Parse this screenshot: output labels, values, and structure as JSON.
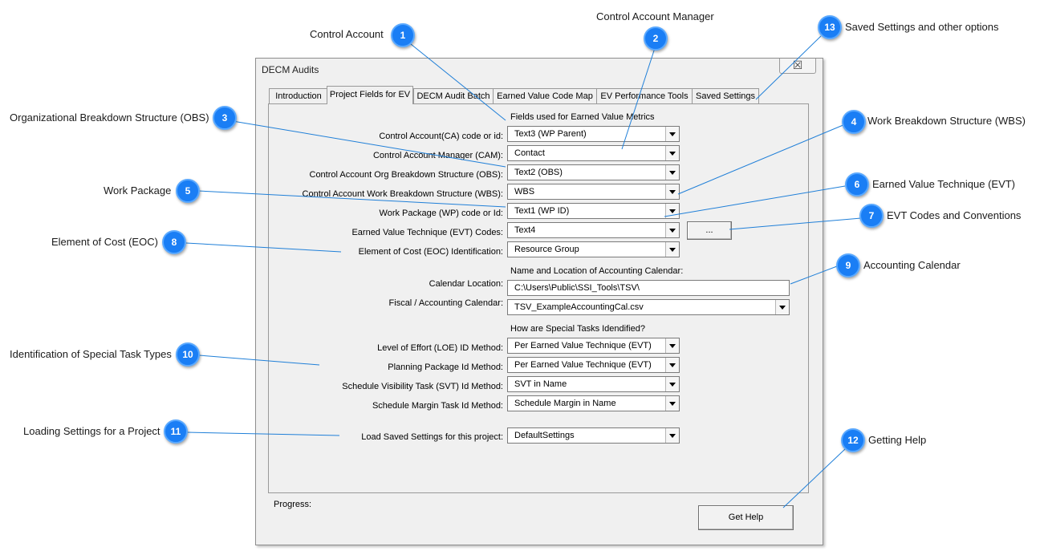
{
  "dialog": {
    "title": "DECM Audits",
    "close_glyph": "☒",
    "tabs": [
      "Introduction",
      "Project Fields for EV",
      "DECM Audit Batch",
      "Earned Value Code Map",
      "EV Performance Tools",
      "Saved Settings"
    ],
    "active_tab": "Project Fields for EV",
    "section_headers": {
      "ev_metrics": "Fields used for Earned Value Metrics",
      "calendar": "Name and Location of Accounting Calendar:",
      "special_tasks": "How are Special Tasks Idendified?"
    },
    "fields": [
      {
        "label": "Control Account(CA) code or id:",
        "value": "Text3 (WP Parent)"
      },
      {
        "label": "Control Account Manager (CAM):",
        "value": "Contact"
      },
      {
        "label": "Control Account Org Breakdown Structure (OBS):",
        "value": "Text2 (OBS)"
      },
      {
        "label": "Control Account Work Breakdown Structure (WBS):",
        "value": "WBS"
      },
      {
        "label": "Work Package (WP) code or Id:",
        "value": "Text1 (WP ID)"
      },
      {
        "label": "Earned Value Technique (EVT) Codes:",
        "value": "Text4"
      },
      {
        "label": "Element of Cost (EOC) Identification:",
        "value": "Resource Group"
      }
    ],
    "evt_button_label": "...",
    "calendar_location_label": "Calendar Location:",
    "calendar_location_value": "C:\\Users\\Public\\SSI_Tools\\TSV\\",
    "fiscal_calendar_label": "Fiscal / Accounting Calendar:",
    "fiscal_calendar_value": "TSV_ExampleAccountingCal.csv",
    "special_fields": [
      {
        "label": "Level of Effort (LOE) ID Method:",
        "value": "Per Earned Value Technique (EVT)"
      },
      {
        "label": "Planning Package Id Method:",
        "value": "Per Earned Value Technique (EVT)"
      },
      {
        "label": "Schedule Visibility Task (SVT) Id Method:",
        "value": "SVT in Name"
      },
      {
        "label": "Schedule Margin Task Id Method:",
        "value": "Schedule Margin in Name"
      }
    ],
    "load_settings_label": "Load Saved Settings for this project:",
    "load_settings_value": "DefaultSettings",
    "progress_label": "Progress:",
    "help_button_label": "Get Help"
  },
  "annotations": [
    {
      "num": "1",
      "text": "Control Account"
    },
    {
      "num": "2",
      "text": "Control Account Manager"
    },
    {
      "num": "3",
      "text": "Organizational Breakdown Structure (OBS)"
    },
    {
      "num": "4",
      "text": "Work Breakdown Structure (WBS)"
    },
    {
      "num": "5",
      "text": "Work Package"
    },
    {
      "num": "6",
      "text": "Earned Value Technique (EVT)"
    },
    {
      "num": "7",
      "text": "EVT Codes and Conventions"
    },
    {
      "num": "8",
      "text": "Element of Cost (EOC)"
    },
    {
      "num": "9",
      "text": "Accounting Calendar"
    },
    {
      "num": "10",
      "text": "Identification of Special Task Types"
    },
    {
      "num": "11",
      "text": "Loading Settings for a Project"
    },
    {
      "num": "12",
      "text": "Getting Help"
    },
    {
      "num": "13",
      "text": "Saved Settings and other options"
    }
  ],
  "colors": {
    "badge": "#1a7ef5",
    "leader_line": "#1f7fd8",
    "dialog_bg": "#f0f0f0"
  }
}
